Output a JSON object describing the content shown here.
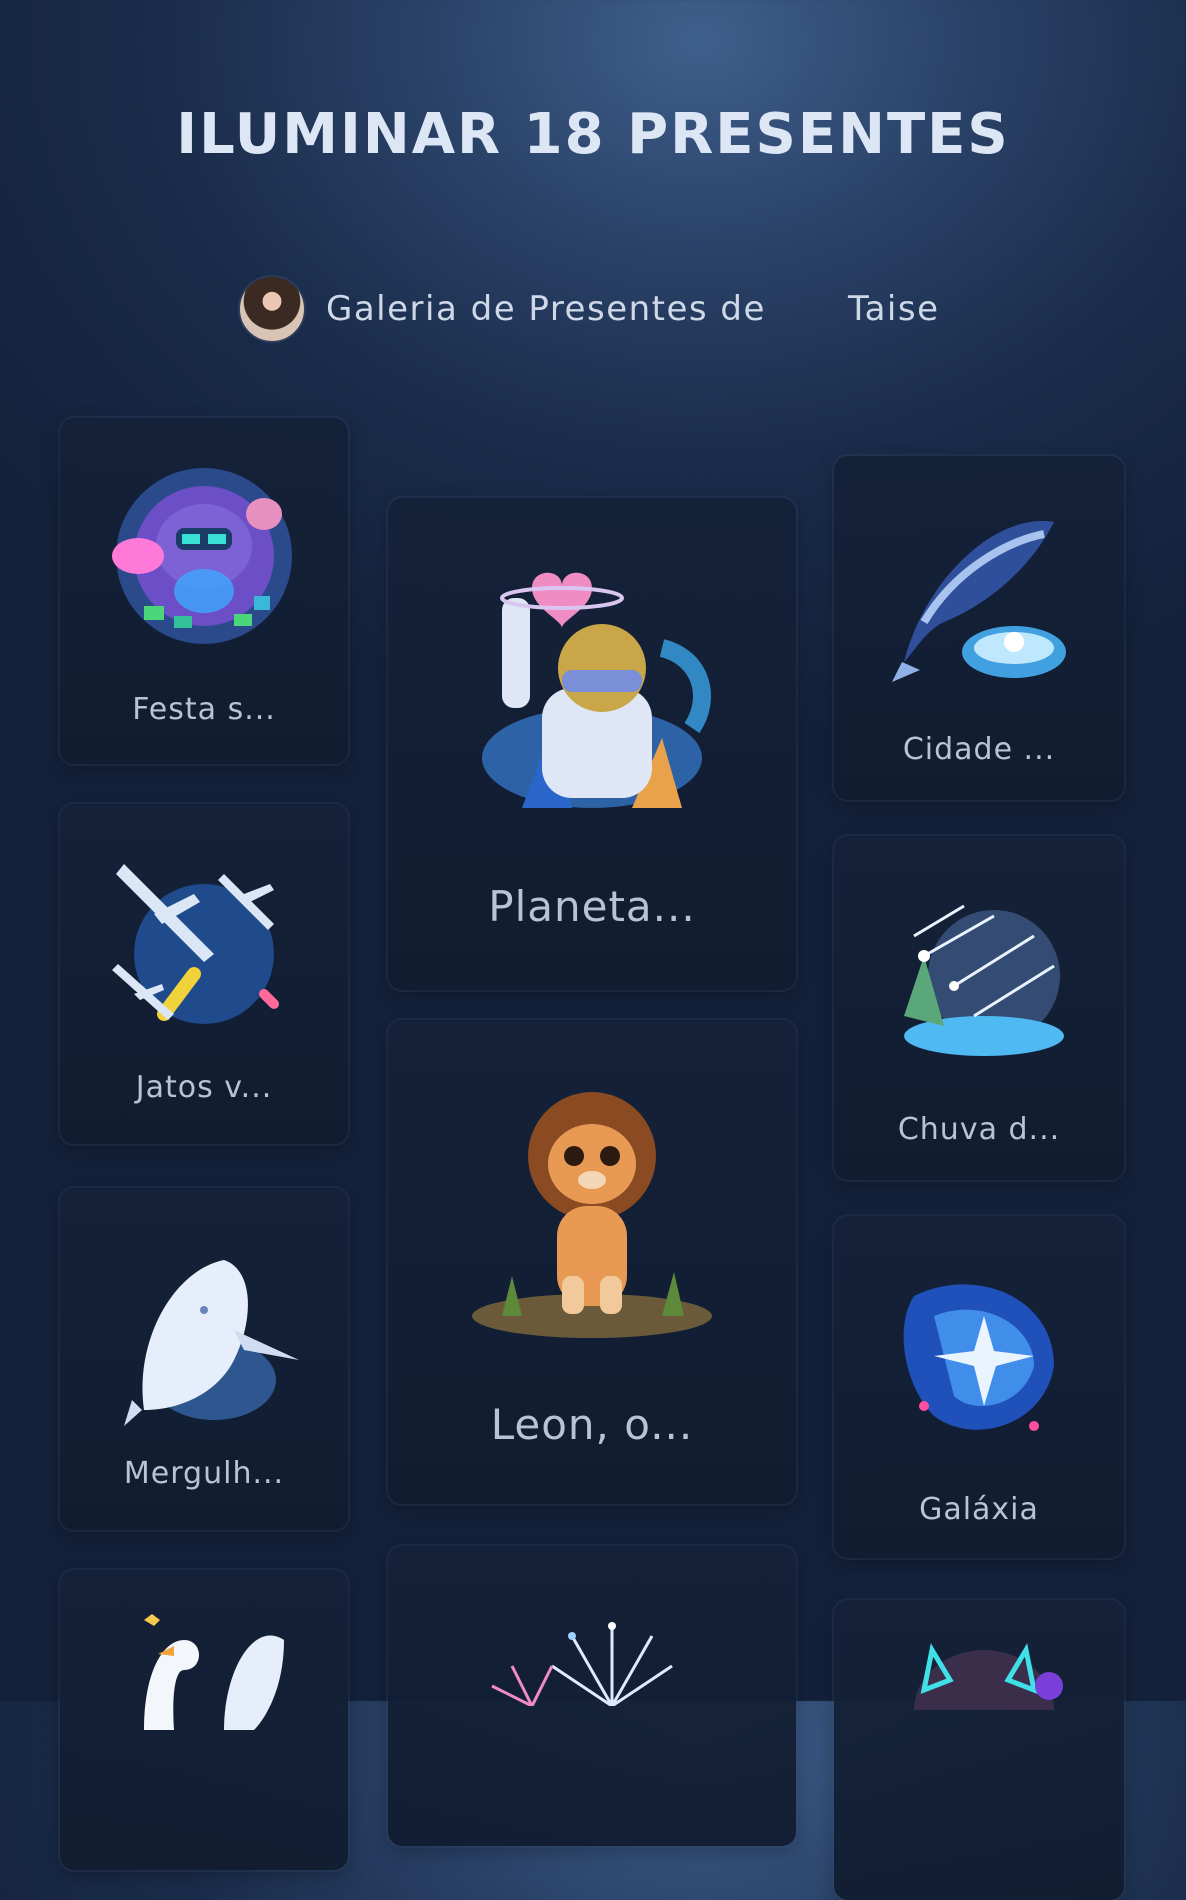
{
  "title": "ILUMINAR 18 PRESENTES",
  "gallery": {
    "label": "Galeria de Presentes de",
    "owner": "Taise"
  },
  "gifts": [
    {
      "label": "Festa s...",
      "icon": "party-cat-icon"
    },
    {
      "label": "Planeta...",
      "icon": "astronaut-planet-icon"
    },
    {
      "label": "Cidade ...",
      "icon": "whale-city-icon"
    },
    {
      "label": "Jatos v...",
      "icon": "jets-icon"
    },
    {
      "label": "Chuva d...",
      "icon": "meteor-shower-icon"
    },
    {
      "label": "Leon, o...",
      "icon": "lion-icon"
    },
    {
      "label": "Mergulh...",
      "icon": "diving-whale-icon"
    },
    {
      "label": "Galáxia",
      "icon": "galaxy-icon"
    },
    {
      "label": "",
      "icon": "swan-icon"
    },
    {
      "label": "",
      "icon": "fireworks-icon"
    },
    {
      "label": "",
      "icon": "cat-helmet-icon"
    }
  ]
}
